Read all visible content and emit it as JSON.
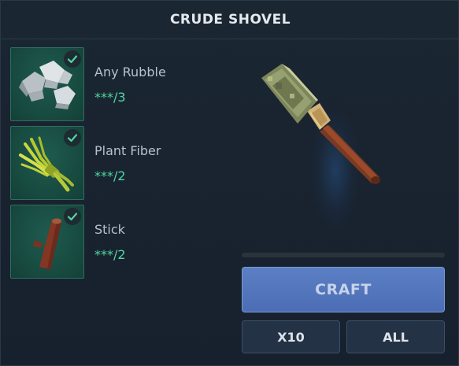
{
  "title": "CRUDE SHOVEL",
  "requirements": [
    {
      "name": "Any Rubble",
      "qty": "***/3",
      "icon": "rubble-icon",
      "satisfied": true
    },
    {
      "name": "Plant Fiber",
      "qty": "***/2",
      "icon": "plant-fiber-icon",
      "satisfied": true
    },
    {
      "name": "Stick",
      "qty": "***/2",
      "icon": "stick-icon",
      "satisfied": true
    }
  ],
  "preview": {
    "icon": "crude-shovel-icon"
  },
  "craft_progress": 0,
  "buttons": {
    "craft": "CRAFT",
    "x10": "X10",
    "all": "ALL"
  },
  "colors": {
    "accent": "#4c6db4",
    "satisfied": "#4fd8a0",
    "slot": "#17493f"
  }
}
